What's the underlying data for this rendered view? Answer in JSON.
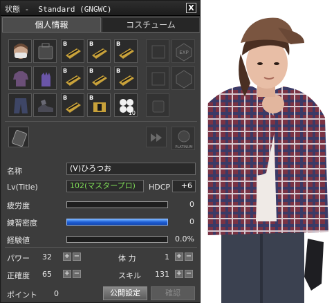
{
  "window": {
    "title": "状態 -  Standard (GNGWC)",
    "close_label": "X"
  },
  "tabs": [
    {
      "label": "個人情報",
      "active": true
    },
    {
      "label": "コスチューム",
      "active": false
    }
  ],
  "equipment": {
    "badge": "B",
    "stack_count": "10",
    "extra_icon_label": "EXP",
    "platinum_label": "PLATINUM"
  },
  "profile": {
    "name_label": "名称",
    "name_value": "(V)ひろつお",
    "level_label": "Lv(Title)",
    "level_value": "102(マスタープロ)",
    "hdcp_label": "HDCP",
    "hdcp_value": "+6"
  },
  "gauges": [
    {
      "label": "疲労度",
      "value": "0",
      "fill": 0
    },
    {
      "label": "練習密度",
      "value": "0",
      "fill": 1
    },
    {
      "label": "経験値",
      "value": "0.0%",
      "fill": 0
    }
  ],
  "stats": {
    "power_label": "パワー",
    "power_value": "32",
    "stamina_label": "体 力",
    "stamina_value": "1",
    "accuracy_label": "正確度",
    "accuracy_value": "65",
    "skill_label": "スキル",
    "skill_value": "131",
    "points_label": "ポイント",
    "points_value": "0",
    "plus": "+",
    "minus": "−"
  },
  "buttons": {
    "public_settings": "公開設定",
    "confirm": "確認"
  },
  "colors": {
    "window_bg": "#3a3a3a",
    "level_text": "#7ed957",
    "practice_bar": "#2a7fff"
  }
}
